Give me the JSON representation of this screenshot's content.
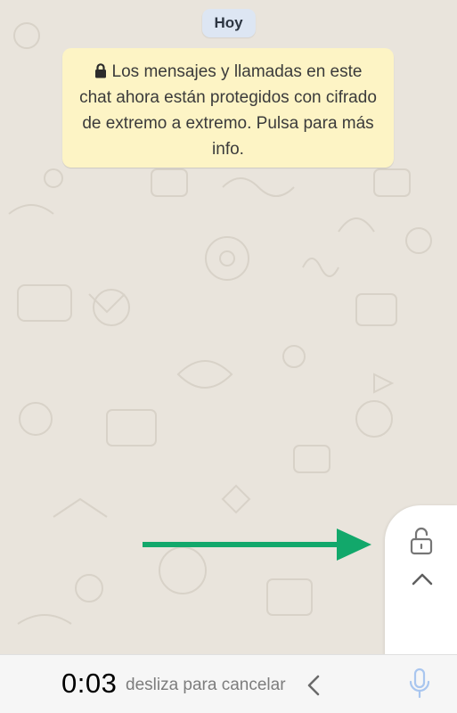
{
  "chat": {
    "date_label": "Hoy",
    "encryption_notice": "Los mensajes y llamadas en este chat ahora están protegidos con cifrado de extremo a extremo. Pulsa para más info."
  },
  "recording": {
    "timer": "0:03",
    "slide_to_cancel": "desliza para cancelar"
  },
  "icons": {
    "notice_icon": "lock-icon",
    "lock_panel_icon": "unlocked-padlock-icon",
    "lock_panel_hint": "chevron-up-icon",
    "cancel_hint": "chevron-left-icon",
    "record_icon": "microphone-icon",
    "annotation": "arrow-right-icon"
  },
  "colors": {
    "wallpaper": "#e9e4dc",
    "date_chip": "#dde6f3",
    "notice_bg": "#fdf4c5",
    "arrow": "#12a86b",
    "mic": "#a9c6ef"
  }
}
